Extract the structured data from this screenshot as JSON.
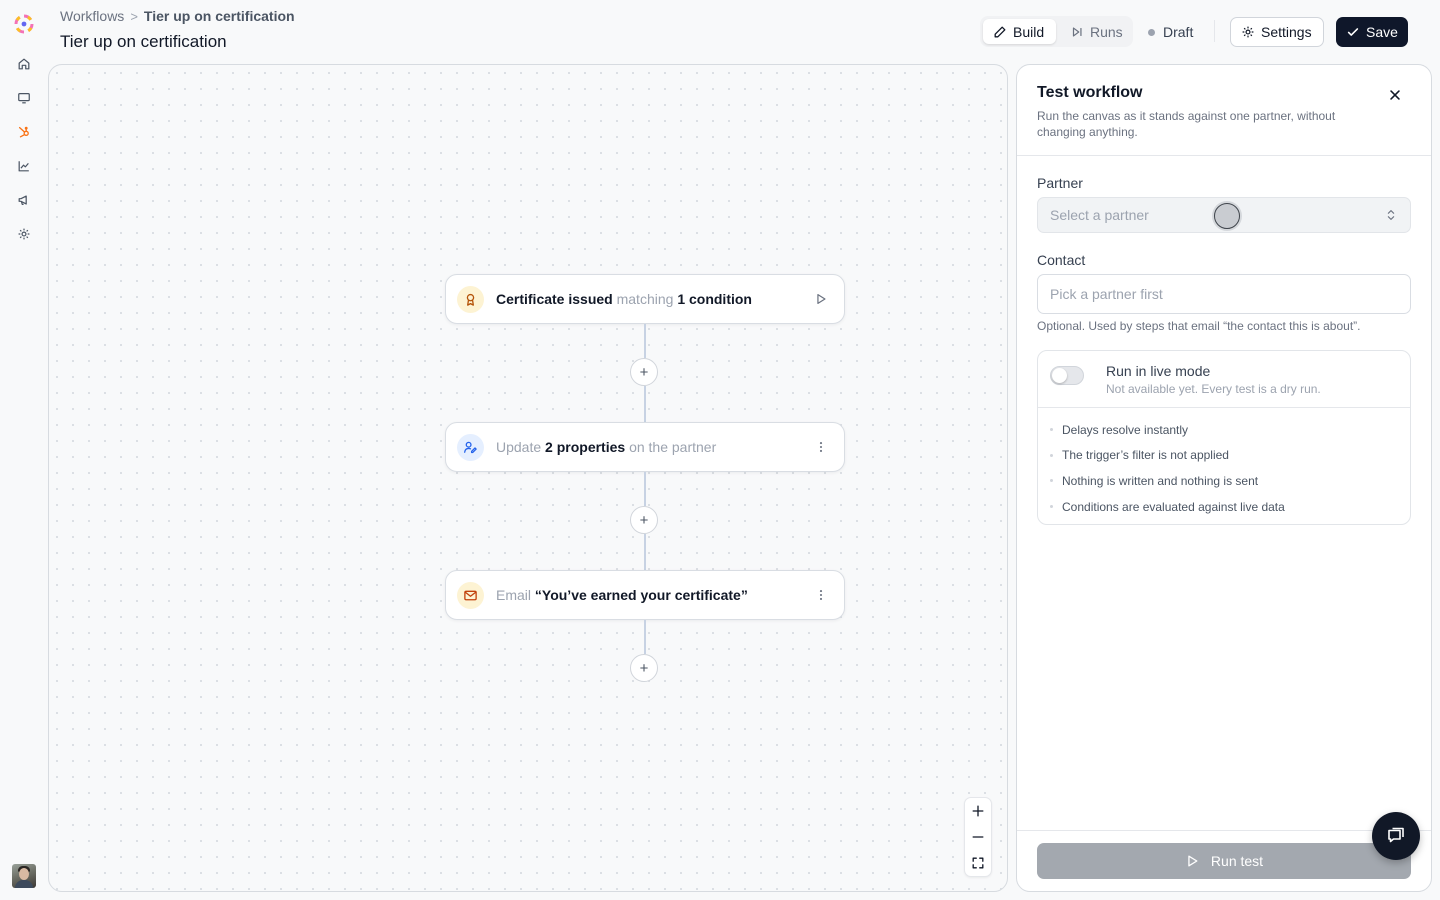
{
  "colors": {
    "accent": "#0f172a",
    "brand_orange": "#f97316",
    "canvas_bg": "#f8f9fa",
    "connector": "#c7d2e3",
    "disabled_button": "#a3a8af"
  },
  "rail": {
    "items": [
      {
        "icon": "home-icon"
      },
      {
        "icon": "monitor-icon"
      },
      {
        "icon": "hubspot-icon"
      },
      {
        "icon": "chart-icon"
      },
      {
        "icon": "megaphone-icon"
      },
      {
        "icon": "settings-icon"
      }
    ]
  },
  "header": {
    "breadcrumb": {
      "parent": "Workflows",
      "separator": ">",
      "current": "Tier up on certification"
    },
    "title": "Tier up on certification",
    "tabs": [
      {
        "label": "Build",
        "icon": "pencil-icon",
        "active": true
      },
      {
        "label": "Runs",
        "icon": "skip-icon",
        "active": false
      }
    ],
    "status": "Draft",
    "settings_label": "Settings",
    "save_label": "Save"
  },
  "canvas": {
    "nodes": [
      {
        "icon": "award-icon",
        "parts": [
          "Certificate issued",
          " matching ",
          "1 condition"
        ],
        "action": "play-icon"
      },
      {
        "icon": "user-edit-icon",
        "parts": [
          "Update ",
          "2 properties",
          " on the partner"
        ],
        "action": "more-vertical-icon"
      },
      {
        "icon": "mail-icon",
        "parts": [
          "Email ",
          "“You’ve earned your certificate”"
        ],
        "action": "more-vertical-icon"
      }
    ],
    "add_label": "+",
    "zoom_controls": [
      "zoom-in-icon",
      "zoom-out-icon",
      "fit-view-icon"
    ]
  },
  "panel": {
    "title": "Test workflow",
    "subtitle": "Run the canvas as it stands against one partner, without changing anything.",
    "partner": {
      "label": "Partner",
      "placeholder": "Select a partner"
    },
    "contact": {
      "label": "Contact",
      "placeholder": "Pick a partner first",
      "hint": "Optional. Used by steps that email “the contact this is about”."
    },
    "live_mode": {
      "title": "Run in live mode",
      "subtitle": "Not available yet. Every test is a dry run.",
      "enabled": false,
      "notes": [
        "Delays resolve instantly",
        "The trigger’s filter is not applied",
        "Nothing is written and nothing is sent",
        "Conditions are evaluated against live data"
      ]
    },
    "run_label": "Run test"
  }
}
